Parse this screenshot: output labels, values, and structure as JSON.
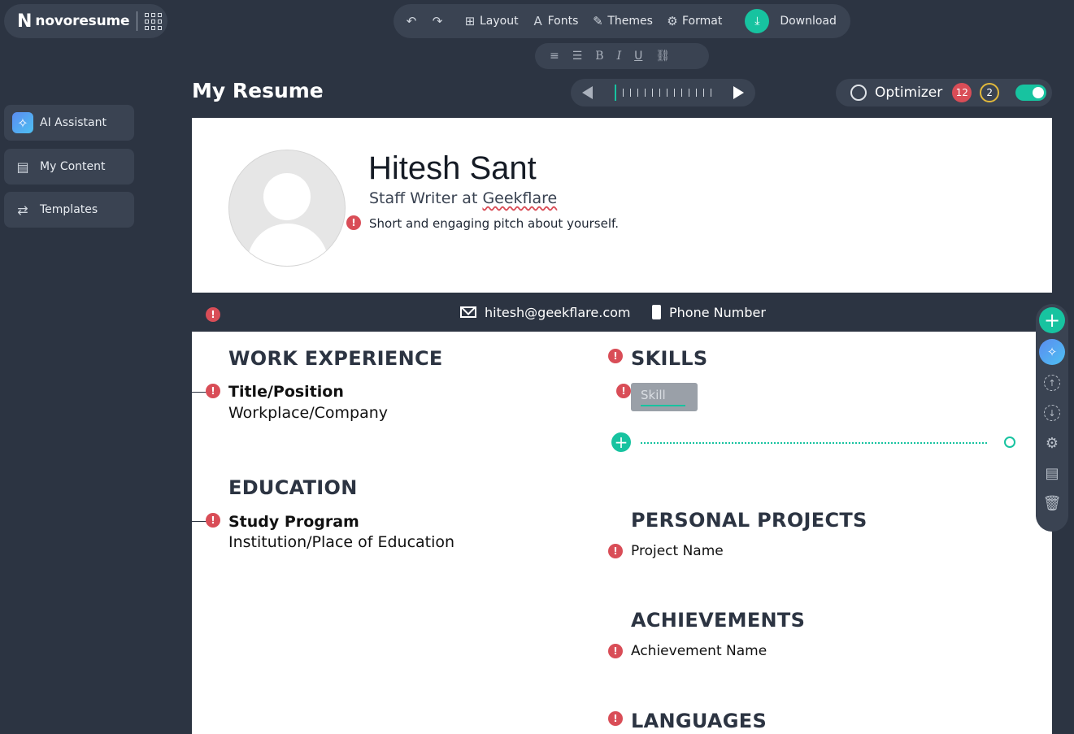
{
  "brand": {
    "name": "novoresume",
    "letter": "N"
  },
  "toolbar": {
    "layout": "Layout",
    "fonts": "Fonts",
    "themes": "Themes",
    "format": "Format",
    "download": "Download"
  },
  "sidebar": {
    "items": [
      {
        "label": "AI Assistant"
      },
      {
        "label": "My Content"
      },
      {
        "label": "Templates"
      }
    ]
  },
  "page_title": "My Resume",
  "optimizer": {
    "label": "Optimizer",
    "errors": "12",
    "warnings": "2",
    "enabled": true
  },
  "resume": {
    "name": "Hitesh Sant",
    "subtitle_prefix": "Staff Writer at ",
    "subtitle_company": "Geekflare",
    "pitch": "Short and engaging pitch about yourself.",
    "contact": {
      "email": "hitesh@geekflare.com",
      "phone": "Phone Number"
    },
    "sections": {
      "work": {
        "title": "WORK EXPERIENCE",
        "item_title": "Title/Position",
        "item_sub": "Workplace/Company"
      },
      "education": {
        "title": "EDUCATION",
        "item_title": "Study Program",
        "item_sub": "Institution/Place of Education"
      },
      "skills": {
        "title": "SKILLS",
        "placeholder": "Skill"
      },
      "projects": {
        "title": "PERSONAL PROJECTS",
        "item": "Project Name"
      },
      "achievements": {
        "title": "ACHIEVEMENTS",
        "item": "Achievement Name"
      },
      "languages": {
        "title": "LANGUAGES"
      }
    }
  },
  "colors": {
    "accent": "#17c3a0",
    "error": "#d94d57",
    "dark": "#2c3442",
    "panel": "#3a4352"
  }
}
